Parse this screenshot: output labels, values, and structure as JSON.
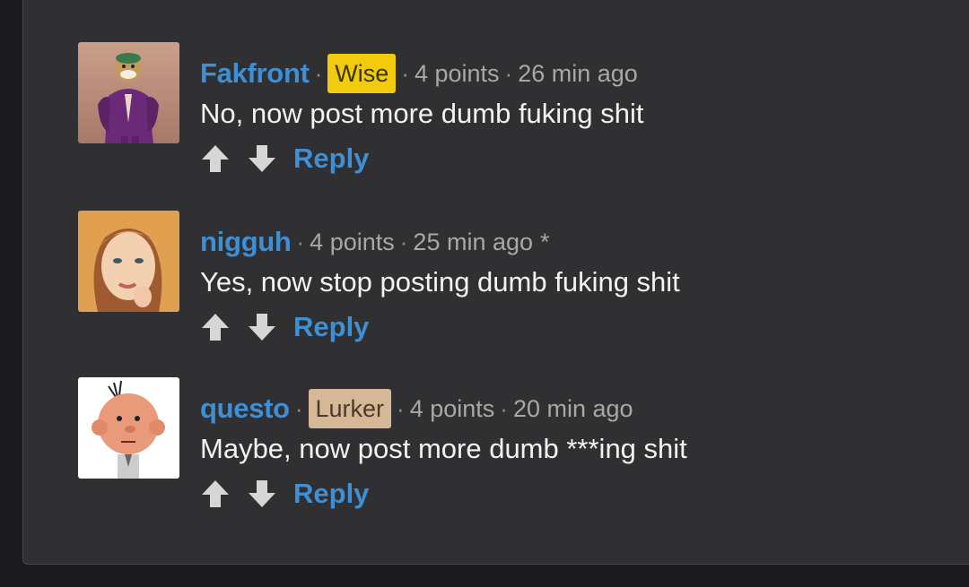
{
  "comments": [
    {
      "username": "Fakfront",
      "badge": "Wise",
      "points": "4 points",
      "time": "26 min ago",
      "edited": "",
      "text": "No, now post more dumb fuking shit",
      "reply_label": "Reply"
    },
    {
      "username": "nigguh",
      "badge": "",
      "points": "4 points",
      "time": "25 min ago",
      "edited": "*",
      "text": "Yes, now stop posting dumb fuking shit",
      "reply_label": "Reply"
    },
    {
      "username": "questo",
      "badge": "Lurker",
      "points": "4 points",
      "time": "20 min ago",
      "edited": "",
      "text": "Maybe, now post more dumb ***ing shit",
      "reply_label": "Reply"
    }
  ],
  "separator": "·",
  "colors": {
    "link": "#3d8fd6",
    "badge_wise": "#f2cc0c",
    "badge_lurker": "#d6b898",
    "background": "#303032"
  },
  "icons": [
    "upvote-arrow-icon",
    "downvote-arrow-icon"
  ]
}
